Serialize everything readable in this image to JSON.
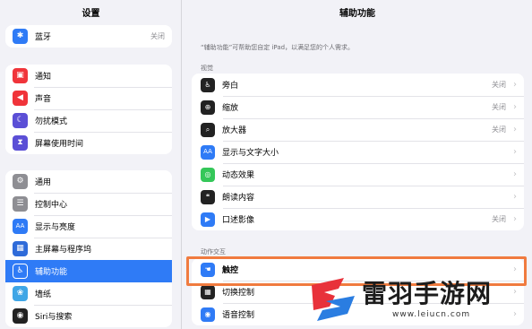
{
  "sidebar": {
    "title": "设置",
    "groups": [
      [
        {
          "label": "蓝牙",
          "value": "关闭",
          "icon": "bluetooth-icon",
          "color": "#2f7bf6"
        }
      ],
      [
        {
          "label": "通知",
          "icon": "notification-icon",
          "color": "#f0343a"
        },
        {
          "label": "声音",
          "icon": "sound-icon",
          "color": "#f0343a"
        },
        {
          "label": "勿扰模式",
          "icon": "moon-icon",
          "color": "#5b4fd6"
        },
        {
          "label": "屏幕使用时间",
          "icon": "hourglass-icon",
          "color": "#5b4fd6"
        }
      ],
      [
        {
          "label": "通用",
          "icon": "gear-icon",
          "color": "#8e8e93"
        },
        {
          "label": "控制中心",
          "icon": "control-center-icon",
          "color": "#8e8e93"
        },
        {
          "label": "显示与亮度",
          "icon": "display-icon",
          "color": "#2f7bf6"
        },
        {
          "label": "主屏幕与程序坞",
          "icon": "home-screen-icon",
          "color": "#2f6bd9"
        },
        {
          "label": "辅助功能",
          "icon": "accessibility-icon",
          "color": "#2f7bf6",
          "selected": true
        },
        {
          "label": "墙纸",
          "icon": "wallpaper-icon",
          "color": "#3fa6e6"
        },
        {
          "label": "Siri与搜索",
          "icon": "siri-icon",
          "color": "#222222"
        }
      ]
    ]
  },
  "main": {
    "title": "辅助功能",
    "description": "“辅助功能”可帮助您自定 iPad，以满足您的个人需求。",
    "sections": [
      {
        "header": "视觉",
        "rows": [
          {
            "label": "旁白",
            "value": "关闭",
            "icon": "voiceover-icon",
            "color": "#222222"
          },
          {
            "label": "缩放",
            "value": "关闭",
            "icon": "zoom-icon",
            "color": "#222222"
          },
          {
            "label": "放大器",
            "value": "关闭",
            "icon": "magnifier-icon",
            "color": "#222222"
          },
          {
            "label": "显示与文字大小",
            "value": "",
            "icon": "text-size-icon",
            "color": "#2f7bf6"
          },
          {
            "label": "动态效果",
            "value": "",
            "icon": "motion-icon",
            "color": "#34c759"
          },
          {
            "label": "朗读内容",
            "value": "",
            "icon": "spoken-content-icon",
            "color": "#222222"
          },
          {
            "label": "口述影像",
            "value": "关闭",
            "icon": "audio-description-icon",
            "color": "#2f7bf6"
          }
        ]
      },
      {
        "header": "动作交互",
        "rows": [
          {
            "label": "触控",
            "value": "",
            "icon": "touch-icon",
            "color": "#2f7bf6"
          },
          {
            "label": "切换控制",
            "value": "",
            "icon": "switch-control-icon",
            "color": "#222222"
          },
          {
            "label": "语音控制",
            "value": "",
            "icon": "voice-control-icon",
            "color": "#2f7bf6"
          }
        ]
      }
    ],
    "highlight_color": "#f07b3f"
  },
  "watermark": {
    "text": "雷羽手游网",
    "url": "www.leiucn.com",
    "colors": {
      "red": "#e8313a",
      "blue": "#2a7de1"
    }
  }
}
